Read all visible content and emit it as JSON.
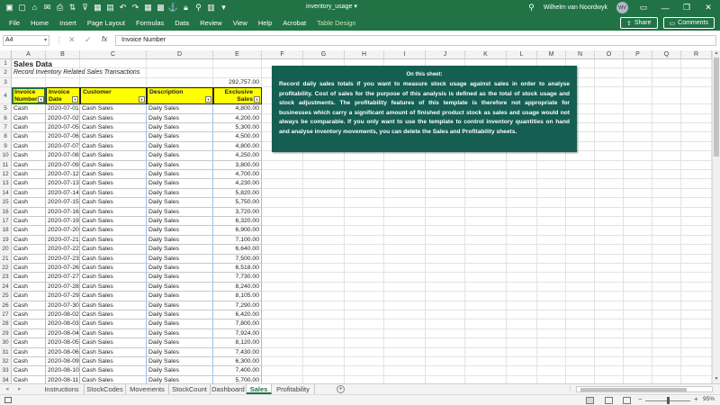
{
  "app": {
    "doc_title": "inventory_usage",
    "user": "Wilhelm van Noordwyk",
    "user_initials": "WV",
    "accent": "#217346"
  },
  "menu": {
    "items": [
      "File",
      "Home",
      "Insert",
      "Page Layout",
      "Formulas",
      "Data",
      "Review",
      "View",
      "Help",
      "Acrobat",
      "Table Design"
    ],
    "share_label": "Share",
    "comments_label": "Comments"
  },
  "formula_bar": {
    "name_box": "A4",
    "value": "Invoice Number"
  },
  "columns": [
    "A",
    "B",
    "C",
    "D",
    "E",
    "F",
    "G",
    "H",
    "I",
    "J",
    "K",
    "L",
    "M",
    "N",
    "O",
    "P",
    "Q",
    "R"
  ],
  "sheet": {
    "title": "Sales Data",
    "subtitle": "Record Inventory Related Sales Transactions",
    "total": "292,757.00",
    "headers": [
      "Invoice Number",
      "Invoice Date",
      "Customer",
      "Description",
      "Exclusive Sales Amount"
    ],
    "rows": [
      [
        "Cash",
        "2020-07-01",
        "Cash Sales",
        "Daily Sales",
        "4,800.00"
      ],
      [
        "Cash",
        "2020-07-02",
        "Cash Sales",
        "Daily Sales",
        "4,200.00"
      ],
      [
        "Cash",
        "2020-07-05",
        "Cash Sales",
        "Daily Sales",
        "5,300.00"
      ],
      [
        "Cash",
        "2020-07-06",
        "Cash Sales",
        "Daily Sales",
        "4,500.00"
      ],
      [
        "Cash",
        "2020-07-07",
        "Cash Sales",
        "Daily Sales",
        "4,800.00"
      ],
      [
        "Cash",
        "2020-07-08",
        "Cash Sales",
        "Daily Sales",
        "4,250.00"
      ],
      [
        "Cash",
        "2020-07-09",
        "Cash Sales",
        "Daily Sales",
        "3,800.00"
      ],
      [
        "Cash",
        "2020-07-12",
        "Cash Sales",
        "Daily Sales",
        "4,700.00"
      ],
      [
        "Cash",
        "2020-07-13",
        "Cash Sales",
        "Daily Sales",
        "4,230.00"
      ],
      [
        "Cash",
        "2020-07-14",
        "Cash Sales",
        "Daily Sales",
        "5,820.00"
      ],
      [
        "Cash",
        "2020-07-15",
        "Cash Sales",
        "Daily Sales",
        "5,750.00"
      ],
      [
        "Cash",
        "2020-07-16",
        "Cash Sales",
        "Daily Sales",
        "3,720.00"
      ],
      [
        "Cash",
        "2020-07-19",
        "Cash Sales",
        "Daily Sales",
        "6,320.00"
      ],
      [
        "Cash",
        "2020-07-20",
        "Cash Sales",
        "Daily Sales",
        "6,900.00"
      ],
      [
        "Cash",
        "2020-07-21",
        "Cash Sales",
        "Daily Sales",
        "7,100.00"
      ],
      [
        "Cash",
        "2020-07-22",
        "Cash Sales",
        "Daily Sales",
        "6,640.00"
      ],
      [
        "Cash",
        "2020-07-23",
        "Cash Sales",
        "Daily Sales",
        "7,500.00"
      ],
      [
        "Cash",
        "2020-07-26",
        "Cash Sales",
        "Daily Sales",
        "6,518.00"
      ],
      [
        "Cash",
        "2020-07-27",
        "Cash Sales",
        "Daily Sales",
        "7,730.00"
      ],
      [
        "Cash",
        "2020-07-28",
        "Cash Sales",
        "Daily Sales",
        "8,240.00"
      ],
      [
        "Cash",
        "2020-07-29",
        "Cash Sales",
        "Daily Sales",
        "8,105.00"
      ],
      [
        "Cash",
        "2020-07-30",
        "Cash Sales",
        "Daily Sales",
        "7,290.00"
      ],
      [
        "Cash",
        "2020-08-02",
        "Cash Sales",
        "Daily Sales",
        "6,420.00"
      ],
      [
        "Cash",
        "2020-08-03",
        "Cash Sales",
        "Daily Sales",
        "7,800.00"
      ],
      [
        "Cash",
        "2020-08-04",
        "Cash Sales",
        "Daily Sales",
        "7,924.00"
      ],
      [
        "Cash",
        "2020-08-05",
        "Cash Sales",
        "Daily Sales",
        "8,120.00"
      ],
      [
        "Cash",
        "2020-08-06",
        "Cash Sales",
        "Daily Sales",
        "7,430.00"
      ],
      [
        "Cash",
        "2020-08-09",
        "Cash Sales",
        "Daily Sales",
        "6,300.00"
      ],
      [
        "Cash",
        "2020-08-10",
        "Cash Sales",
        "Daily Sales",
        "7,400.00"
      ],
      [
        "Cash",
        "2020-08-11",
        "Cash Sales",
        "Daily Sales",
        "5,700.00"
      ]
    ]
  },
  "note": {
    "title": "On this sheet:",
    "body": "Record daily sales totals if you want to measure stock usage against sales in order to analyse profitability. Cost of sales for the purpose of this analysis is defined as the total of stock usage and stock adjustments. The profitability features of this template is therefore not appropriate for businesses which carry a significant amount of finished product stock as sales and usage would not always be comparable. If you only want to use the template to control inventory quantities on hand and analyse inventory movements, you can delete the Sales and Profitability sheets.",
    "bg_color": "#145e52"
  },
  "tabs": {
    "items": [
      "Instructions",
      "StockCodes",
      "Movements",
      "StockCount",
      "Dashboard",
      "Sales",
      "Profitability"
    ],
    "active": "Sales"
  },
  "status": {
    "zoom": "95%"
  }
}
